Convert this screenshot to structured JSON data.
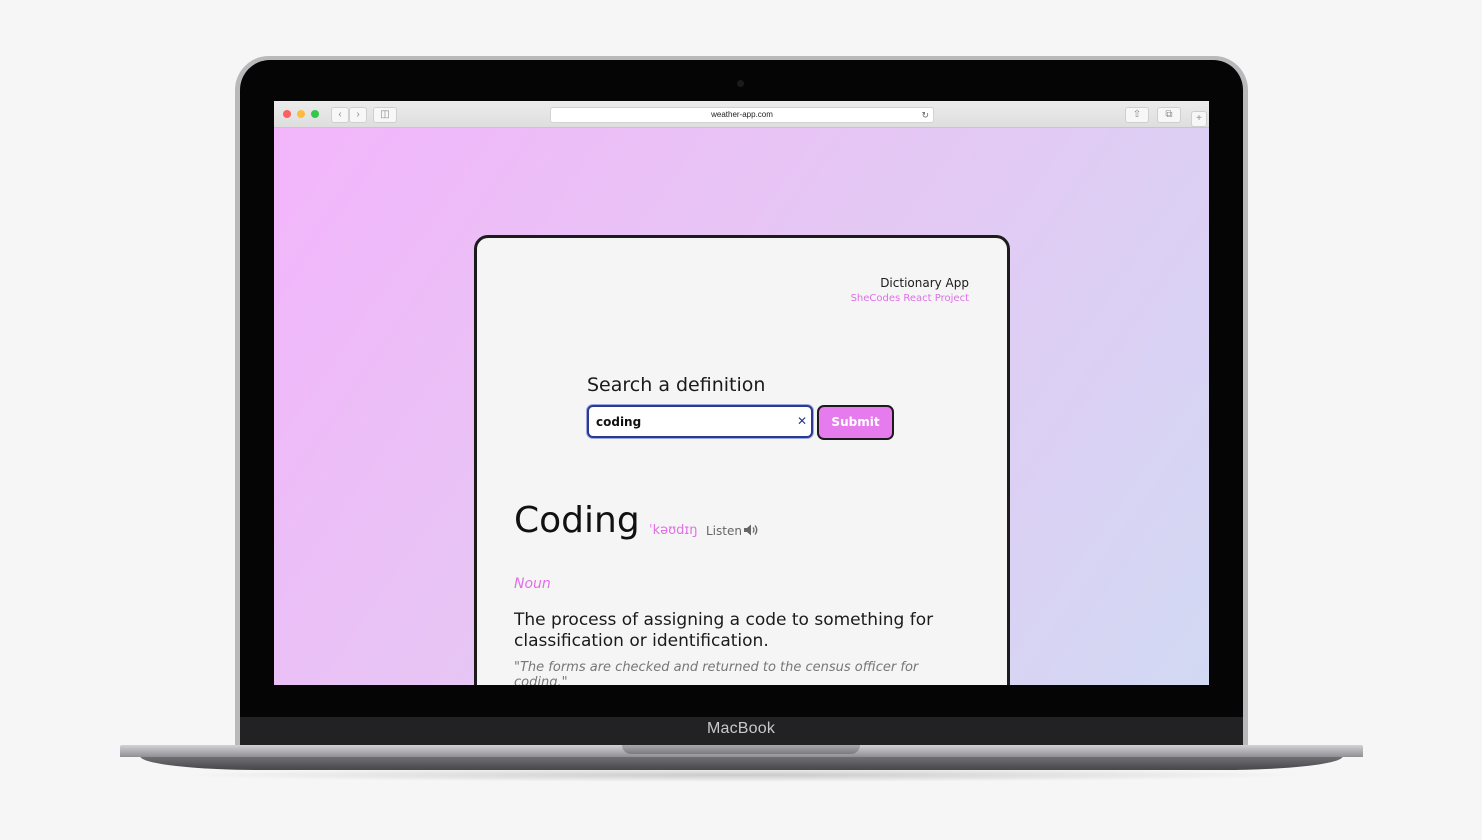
{
  "device": {
    "brand": "MacBook"
  },
  "browser": {
    "url": "weather-app.com"
  },
  "app": {
    "title": "Dictionary App",
    "subtitle": "SheCodes React Project"
  },
  "search": {
    "heading": "Search a definition",
    "value": "coding",
    "submit_label": "Submit"
  },
  "result": {
    "word": "Coding",
    "phonetic": "ˈkəʊdɪŋ",
    "listen_label": "Listen",
    "part_of_speech": "Noun",
    "definition": "The process of assigning a code to something for classification or identification.",
    "example": "\"The forms are checked and returned to the census officer for coding.\""
  },
  "colors": {
    "accent": "#df6fe6",
    "button": "#e67bee",
    "gradient_start": "#f3b5fb",
    "gradient_end": "#d2d9f3"
  },
  "icons": {
    "clear": "close-icon",
    "speaker": "speaker-icon",
    "reload": "reload-icon"
  }
}
